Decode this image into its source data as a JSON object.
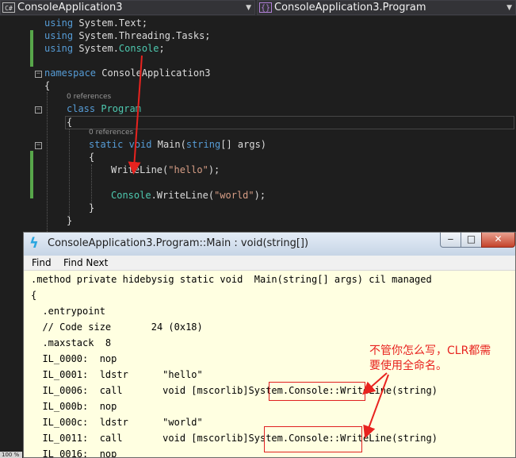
{
  "nav": {
    "left_icon": "C#",
    "left_label": "ConsoleApplication3",
    "right_icon": "{}",
    "right_label": "ConsoleApplication3.Program"
  },
  "code": {
    "using1_kw": "using",
    "using1_ns": " System.Text;",
    "using2_kw": "using",
    "using2_ns": " System.Threading.Tasks;",
    "using3_kw": "using",
    "using3_ns1": " System.",
    "using3_ty": "Console",
    "using3_end": ";",
    "namespace_kw": "namespace",
    "namespace_name": " ConsoleApplication3",
    "brace_open": "{",
    "refs1": "0 references",
    "class_kw": "class",
    "class_name": "Program",
    "brace_open2": "{",
    "refs2": "0 references",
    "static_kw": "static",
    "void_kw": "void",
    "main_sig1": " Main(",
    "string_kw": "string",
    "main_sig2": "[] args)",
    "brace_open3": "{",
    "line_write1_a": "WriteLine(",
    "line_write1_s": "\"hello\"",
    "line_write1_b": ");",
    "line_write2_ty": "Console",
    "line_write2_a": ".WriteLine(",
    "line_write2_s": "\"world\"",
    "line_write2_b": ");",
    "brace_close3": "}",
    "brace_close2": "}"
  },
  "il_window": {
    "title": "ConsoleApplication3.Program::Main : void(string[])",
    "btn_min": "‒",
    "btn_max": "□",
    "btn_close": "✕",
    "menu_find": "Find",
    "menu_find_next": "Find Next",
    "lines": [
      ".method private hidebysig static void  Main(string[] args) cil managed",
      "{",
      "  .entrypoint",
      "  // Code size       24 (0x18)",
      "  .maxstack  8",
      "  IL_0000:  nop",
      "  IL_0001:  ldstr      \"hello\"",
      "  IL_0006:  call       void [mscorlib]System.Console::WriteLine(string)",
      "  IL_000b:  nop",
      "  IL_000c:  ldstr      \"world\"",
      "  IL_0011:  call       void [mscorlib]System.Console::WriteLine(string)",
      "  IL_0016:  nop"
    ]
  },
  "annotation": {
    "line1": "不管你怎么写，CLR都需",
    "line2": "要使用全命名。"
  },
  "zoom": "100 %",
  "colors": {
    "annotation_red": "#e8231f",
    "keyword_blue": "#569cd6",
    "type_teal": "#4ec9b0",
    "string_brown": "#d69d85"
  }
}
